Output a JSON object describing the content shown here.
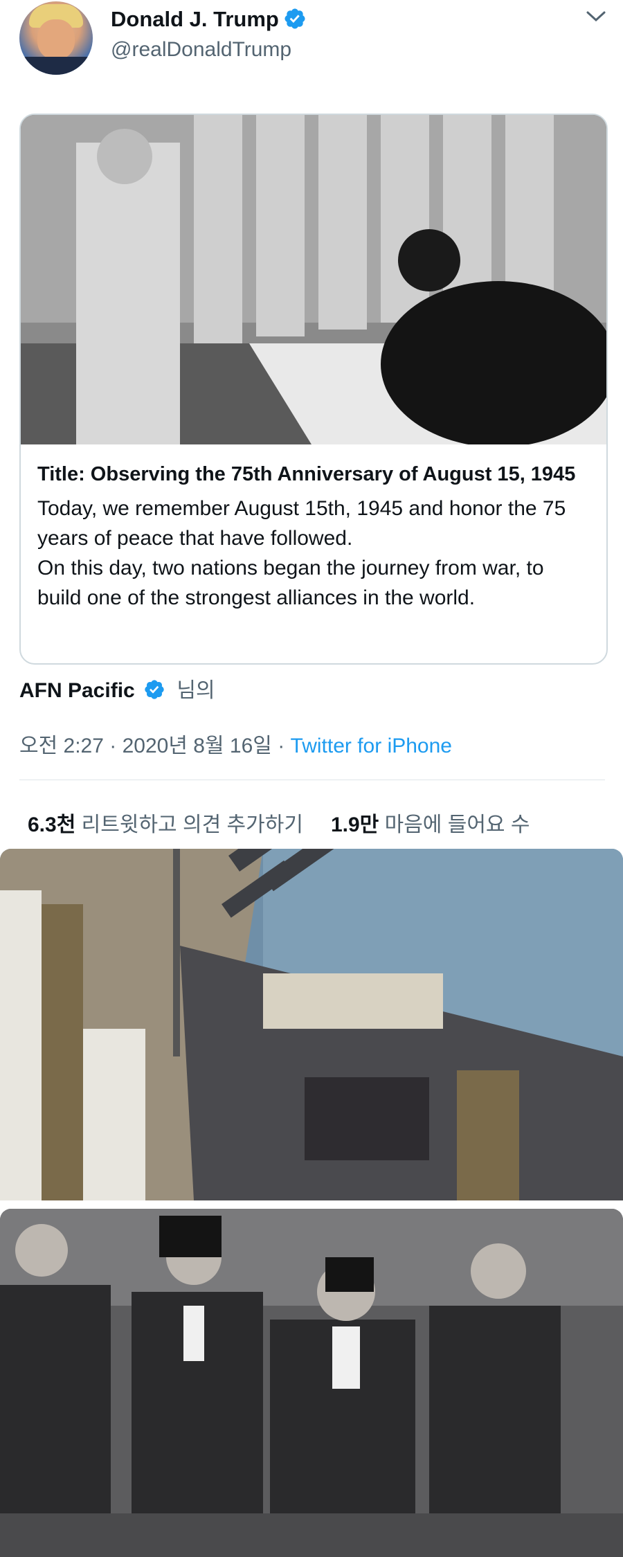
{
  "user": {
    "display_name": "Donald J. Trump",
    "handle": "@realDonaldTrump",
    "verified_icon": "verified-badge-icon",
    "menu_icon": "chevron-down-icon"
  },
  "card": {
    "title": "Title: Observing the 75th Anniversary of August 15, 1945",
    "description": "Today, we remember August 15th, 1945 and honor the 75 years of peace that have followed.\nOn this day, two nations began the journey from war, to build one of the strongest alliances in the world."
  },
  "source": {
    "name": "AFN Pacific",
    "suffix": "님의"
  },
  "meta": {
    "time": "오전 2:27",
    "separator1": " · ",
    "date": "2020년 8월 16일",
    "separator2": " · ",
    "client": "Twitter for iPhone"
  },
  "stats": {
    "retweets_count": "6.3천",
    "retweets_label": "리트윗하고 의견 추가하기",
    "likes_count": "1.9만",
    "likes_label": "마음에 들어요 수"
  },
  "colors": {
    "accent": "#1d9bf0",
    "secondary_text": "#536471",
    "border": "#cfd9de"
  }
}
